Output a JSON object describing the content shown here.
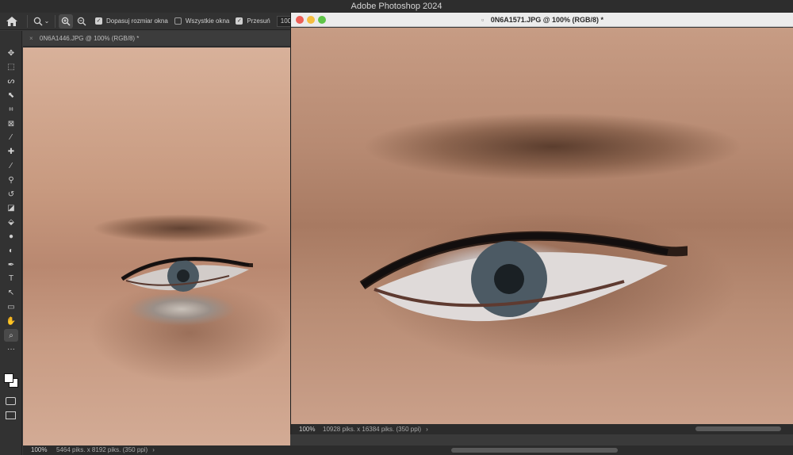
{
  "app": {
    "title": "Adobe Photoshop 2024"
  },
  "options_bar": {
    "zoom_dropdown_arrow": "⌄",
    "fit_window_label": "Dopasuj rozmiar okna",
    "fit_window_checked": true,
    "all_windows_label": "Wszystkie okna",
    "all_windows_checked": false,
    "scrubby_label": "Przesuń",
    "scrubby_checked": true,
    "zoom_value": "100%"
  },
  "toolbar": {
    "icons": [
      "move-icon",
      "marquee-icon",
      "lasso-icon",
      "object-select-icon",
      "crop-icon",
      "frame-icon",
      "eyedropper-icon",
      "healing-brush-icon",
      "brush-icon",
      "clone-stamp-icon",
      "history-brush-icon",
      "eraser-icon",
      "paint-bucket-icon",
      "blur-icon",
      "dodge-icon",
      "pen-icon",
      "type-icon",
      "path-select-icon",
      "rectangle-icon",
      "hand-icon",
      "zoom-icon",
      "more-tools-icon"
    ],
    "glyphs": [
      "✥",
      "⬚",
      "ᔕ",
      "⬉",
      "⌗",
      "⊠",
      "⁄",
      "✚",
      "∕",
      "⚲",
      "↺",
      "◪",
      "⬙",
      "●",
      "◐",
      "✒",
      "T",
      "↖",
      "▭",
      "✋",
      "⌕",
      "···"
    ]
  },
  "doc1": {
    "tab_close": "×",
    "tab_title": "0N6A1446.JPG @ 100% (RGB/8) *",
    "zoom": "100%",
    "info": "5464 piks. x 8192 piks. (350 ppi)",
    "info_arrow": "›"
  },
  "doc2": {
    "doc_icon": "▫",
    "title": "0N6A1571.JPG @ 100% (RGB/8) *",
    "zoom": "100%",
    "info": "10928 piks. x 16384 piks. (350 ppi)",
    "info_arrow": "›"
  },
  "colors": {
    "fill_close": "#ec5f57",
    "fill_minimize": "#f5be3f",
    "fill_zoom": "#5fc548"
  }
}
